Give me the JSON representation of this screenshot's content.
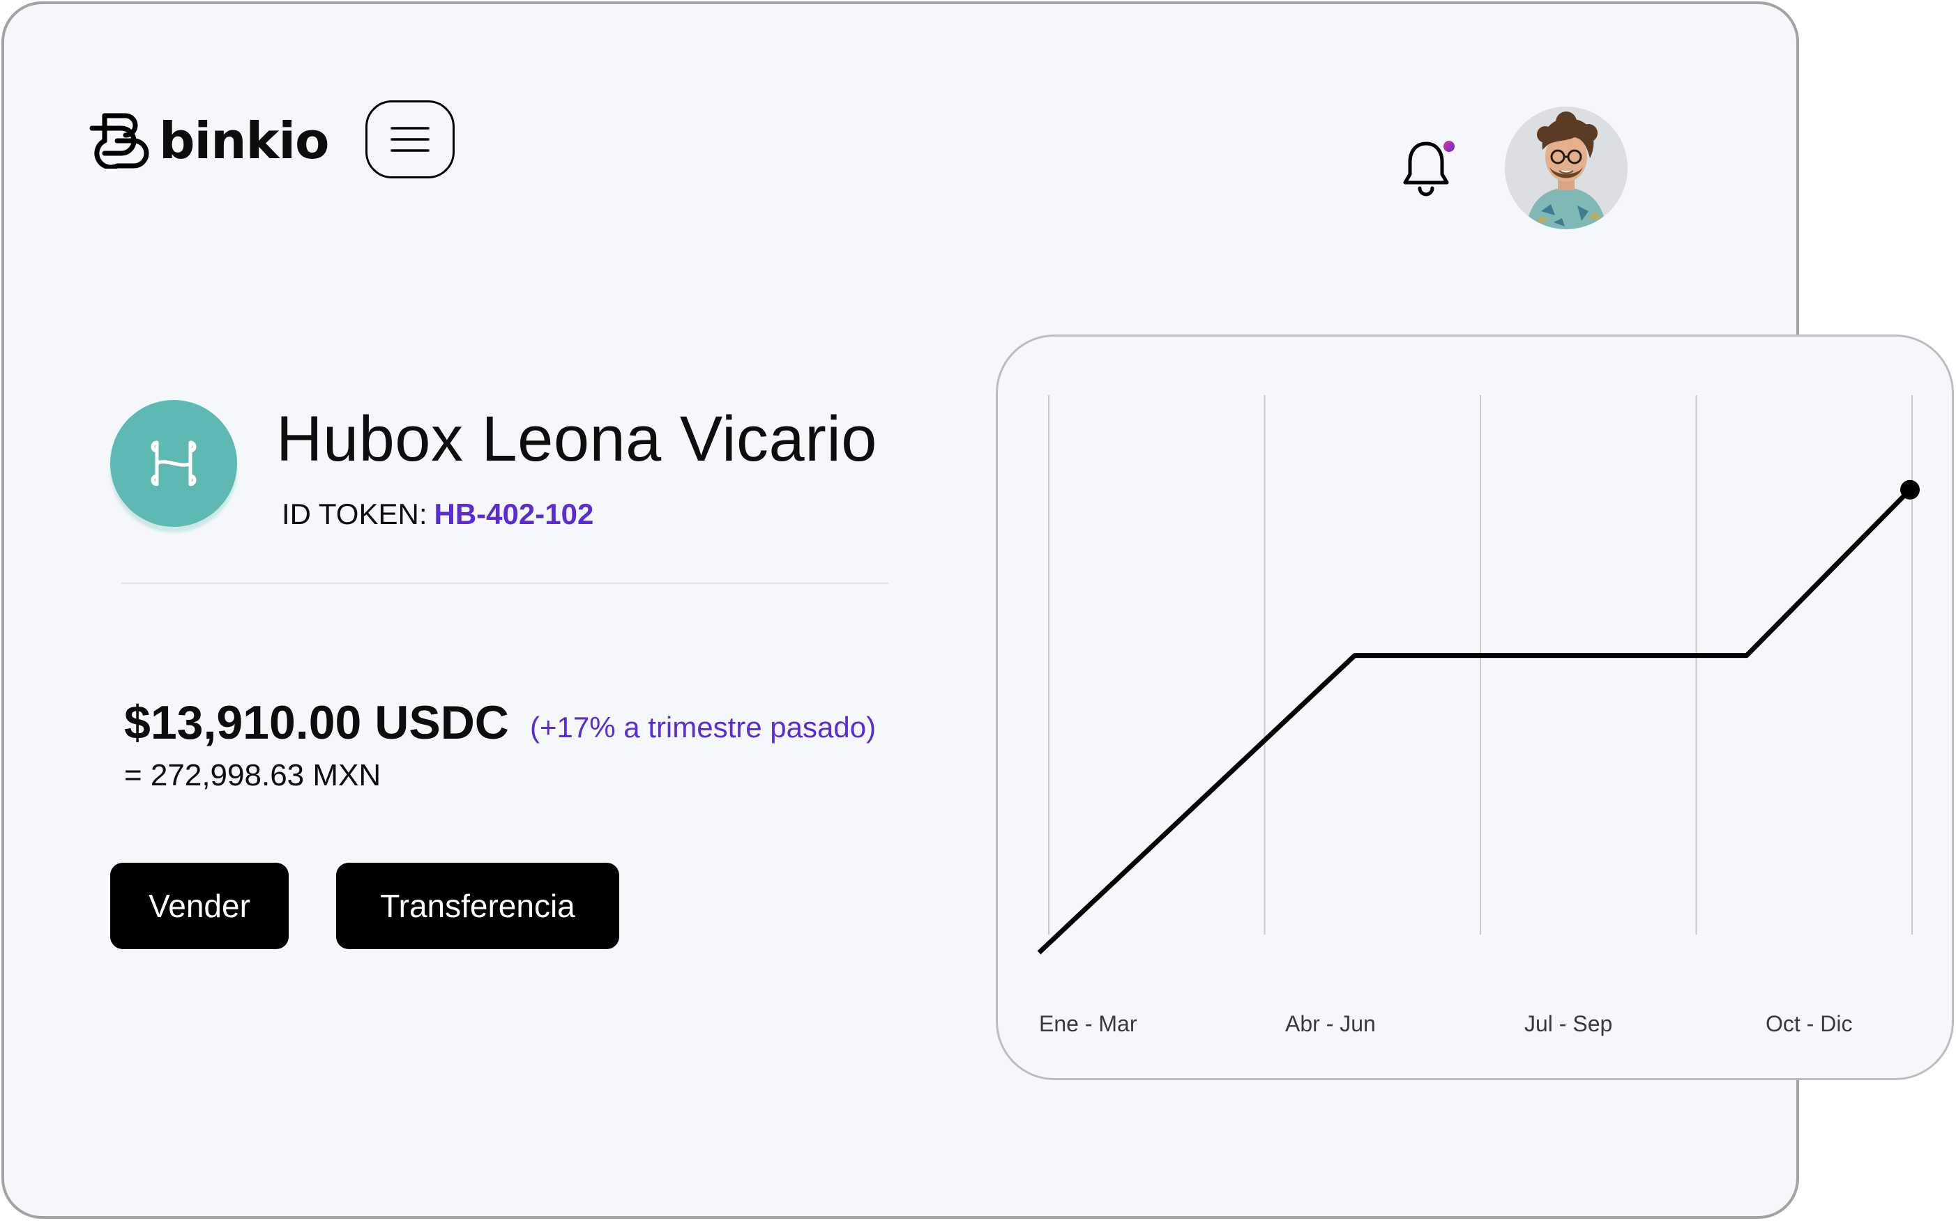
{
  "app": {
    "logo_text": "binkio",
    "logo_icon": "binkio-logo-icon",
    "menu_icon": "hamburger-menu-icon",
    "notification_icon": "bell-icon",
    "avatar_icon": "user-avatar"
  },
  "asset": {
    "icon": "hubox-logo-icon",
    "title": "Hubox Leona Vicario",
    "token_label": "ID TOKEN:",
    "token_value": "HB-402-102"
  },
  "balance": {
    "usdc": "$13,910.00 USDC",
    "change": "(+17% a trimestre pasado)",
    "mxn": "= 272,998.63 MXN"
  },
  "actions": {
    "sell": "Vender",
    "transfer": "Transferencia"
  },
  "colors": {
    "accent": "#5a2cd6",
    "token_avatar": "#5fb9b3",
    "button": "#000000",
    "background": "#f5f8fb"
  },
  "chart_data": {
    "type": "line",
    "categories": [
      "Ene - Mar",
      "Abr - Jun",
      "Jul - Sep",
      "Oct - Dic"
    ],
    "x": [
      0,
      1.45,
      3.25,
      4.0
    ],
    "values": [
      0,
      52,
      52,
      81
    ],
    "xlim": [
      0,
      4
    ],
    "ylim": [
      0,
      100
    ],
    "grid": "vertical",
    "end_marker": true
  }
}
